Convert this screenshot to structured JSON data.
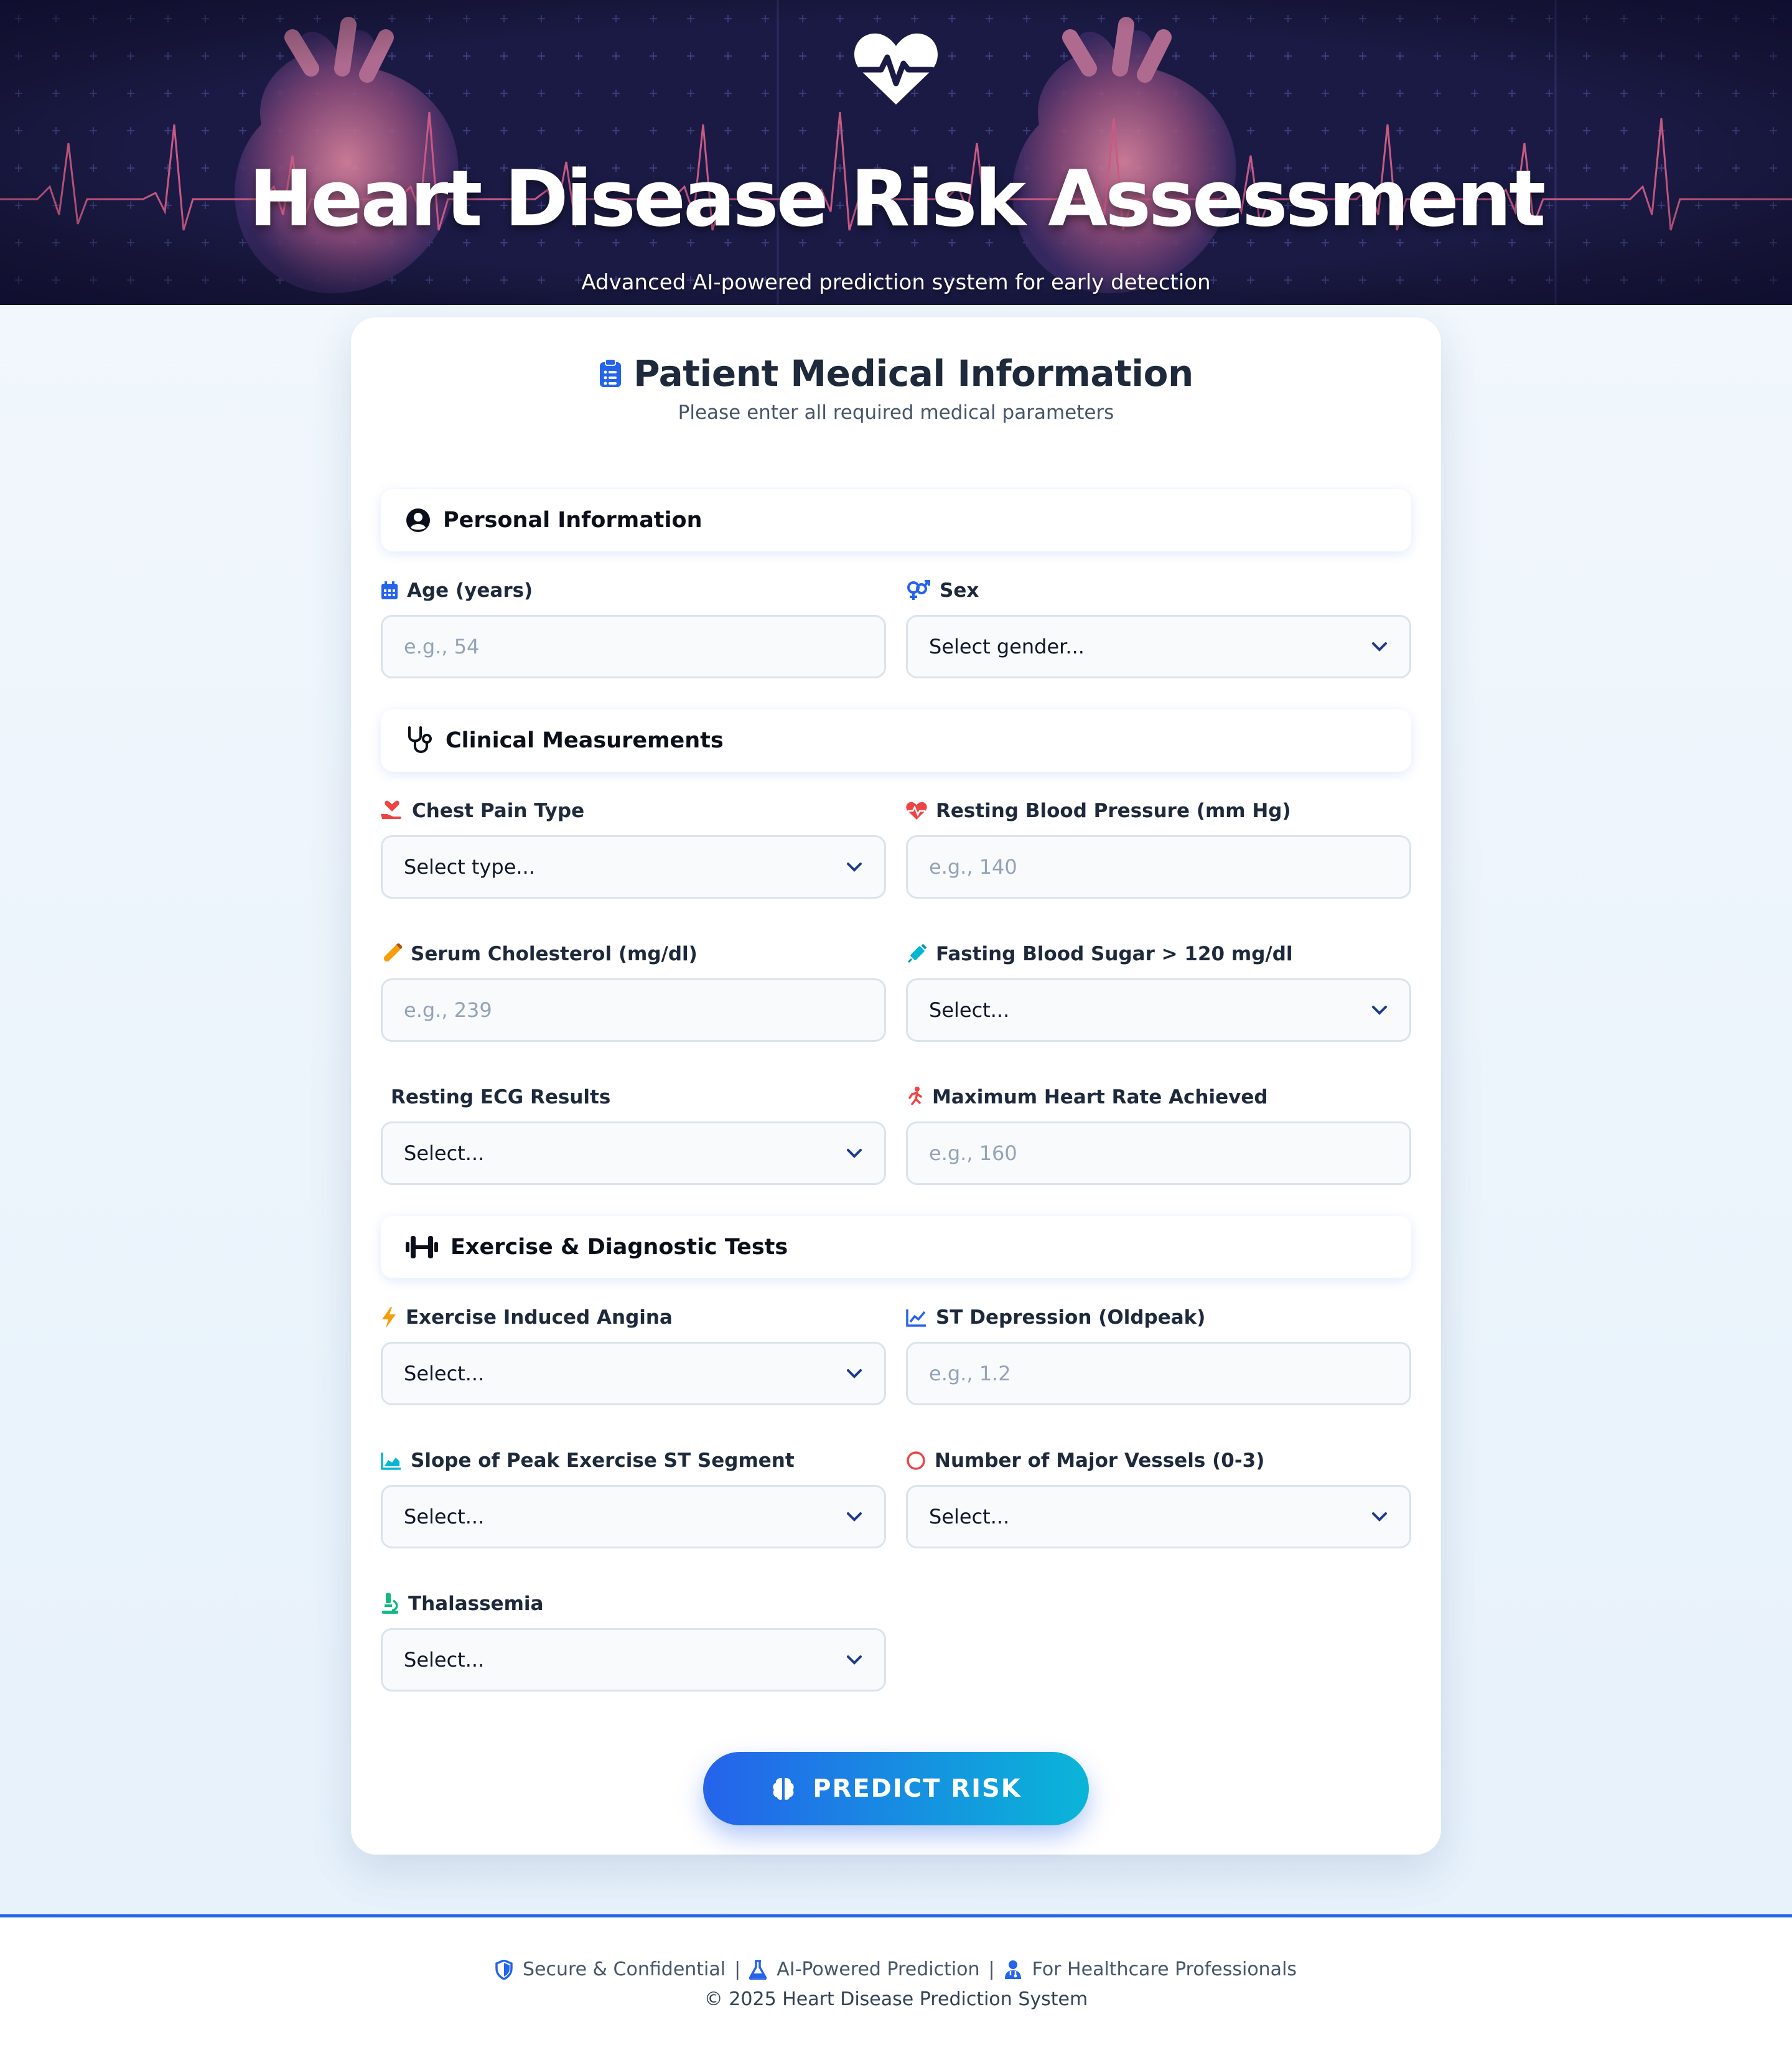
{
  "header": {
    "title": "Heart Disease Risk Assessment",
    "subtitle": "Advanced AI-powered prediction system for early detection",
    "logo_icon": "heart-pulse-icon"
  },
  "form": {
    "title": "Patient Medical Information",
    "subtitle": "Please enter all required medical parameters",
    "title_icon": "clipboard-icon",
    "sections": {
      "personal": {
        "title": "Personal Information",
        "icon": "user-circle-icon"
      },
      "clinical": {
        "title": "Clinical Measurements",
        "icon": "stethoscope-icon"
      },
      "exercise": {
        "title": "Exercise & Diagnostic Tests",
        "icon": "dumbbell-icon"
      }
    },
    "fields": {
      "age": {
        "label": "Age (years)",
        "placeholder": "e.g., 54",
        "icon": "calendar-icon",
        "type": "input"
      },
      "sex": {
        "label": "Sex",
        "value": "Select gender...",
        "icon": "gender-icon",
        "type": "select"
      },
      "chest_pain": {
        "label": "Chest Pain Type",
        "value": "Select type...",
        "icon": "hand-holding-heart-icon",
        "type": "select"
      },
      "resting_bp": {
        "label": "Resting Blood Pressure (mm Hg)",
        "placeholder": "e.g., 140",
        "icon": "heart-pulse-icon",
        "type": "input"
      },
      "cholesterol": {
        "label": "Serum Cholesterol (mg/dl)",
        "placeholder": "e.g., 239",
        "icon": "vial-icon",
        "type": "input"
      },
      "fasting_sugar": {
        "label": "Fasting Blood Sugar > 120 mg/dl",
        "value": "Select...",
        "icon": "syringe-icon",
        "type": "select"
      },
      "resting_ecg": {
        "label": "Resting ECG Results",
        "value": "Select...",
        "icon": "",
        "type": "select"
      },
      "max_hr": {
        "label": "Maximum Heart Rate Achieved",
        "placeholder": "e.g., 160",
        "icon": "running-icon",
        "type": "input"
      },
      "angina": {
        "label": "Exercise Induced Angina",
        "value": "Select...",
        "icon": "bolt-icon",
        "type": "select"
      },
      "oldpeak": {
        "label": "ST Depression (Oldpeak)",
        "placeholder": "e.g., 1.2",
        "icon": "chart-line-icon",
        "type": "input"
      },
      "slope": {
        "label": "Slope of Peak Exercise ST Segment",
        "value": "Select...",
        "icon": "chart-area-icon",
        "type": "select"
      },
      "vessels": {
        "label": "Number of Major Vessels (0-3)",
        "value": "Select...",
        "icon": "circle-icon",
        "type": "select"
      },
      "thal": {
        "label": "Thalassemia",
        "value": "Select...",
        "icon": "microscope-icon",
        "type": "select"
      }
    },
    "submit": {
      "label": "PREDICT RISK",
      "icon": "brain-icon"
    }
  },
  "footer": {
    "links": [
      {
        "label": "Secure & Confidential",
        "icon": "shield-icon"
      },
      {
        "label": "AI-Powered Prediction",
        "icon": "flask-icon"
      },
      {
        "label": "For Healthcare Professionals",
        "icon": "user-doctor-icon"
      }
    ],
    "separator": "|",
    "copyright": "© 2025 Heart Disease Prediction System"
  },
  "colors": {
    "primary": "#2563eb",
    "accent": "#06b6d4",
    "hero_bg": "#1b1a45",
    "danger": "#ef4444",
    "warning": "#f59e0b",
    "success": "#10b981"
  }
}
